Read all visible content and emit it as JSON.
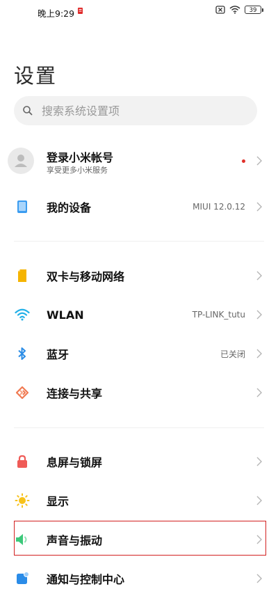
{
  "status_bar": {
    "time": "晚上9:29",
    "battery": "39"
  },
  "page_title": "设置",
  "search": {
    "placeholder": "搜索系统设置项"
  },
  "account": {
    "title": "登录小米帐号",
    "subtitle": "享受更多小米服务"
  },
  "sections": [
    {
      "items": [
        {
          "id": "my-device",
          "label": "我的设备",
          "value": "MIUI 12.0.12",
          "icon": "phone-icon",
          "color": "#3b9cf0"
        }
      ]
    },
    {
      "items": [
        {
          "id": "dual-sim",
          "label": "双卡与移动网络",
          "value": "",
          "icon": "sim-card-icon",
          "color": "#f5b400"
        },
        {
          "id": "wlan",
          "label": "WLAN",
          "value": "TP-LINK_tutu",
          "icon": "wifi-icon",
          "color": "#22b0e8"
        },
        {
          "id": "bluetooth",
          "label": "蓝牙",
          "value": "已关闭",
          "icon": "bluetooth-icon",
          "color": "#2c8de6"
        },
        {
          "id": "connection-sharing",
          "label": "连接与共享",
          "value": "",
          "icon": "share-icon",
          "color": "#f07a52"
        }
      ]
    },
    {
      "items": [
        {
          "id": "lock-screen",
          "label": "息屏与锁屏",
          "value": "",
          "icon": "lock-icon",
          "color": "#ef5b57"
        },
        {
          "id": "display",
          "label": "显示",
          "value": "",
          "icon": "sun-icon",
          "color": "#f7c21b"
        },
        {
          "id": "sound-vibration",
          "label": "声音与振动",
          "value": "",
          "icon": "speaker-icon",
          "color": "#3cc87a"
        },
        {
          "id": "notification-control",
          "label": "通知与控制中心",
          "value": "",
          "icon": "notification-icon",
          "color": "#2a8ce8"
        }
      ]
    }
  ],
  "highlight_color": "#d21f1f"
}
